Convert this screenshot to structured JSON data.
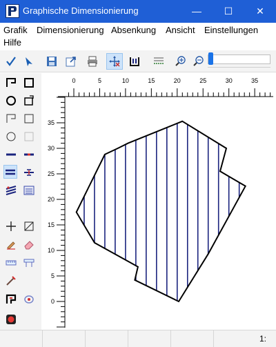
{
  "window": {
    "title": "Graphische Dimensionierung",
    "controls": {
      "minimize": "—",
      "maximize": "☐",
      "close": "✕"
    }
  },
  "menu": {
    "items": [
      "Grafik",
      "Dimensionierung",
      "Absenkung",
      "Ansicht",
      "Einstellungen",
      "Hilfe"
    ]
  },
  "toolbar": {
    "buttons": [
      "check-icon",
      "arrow-select-icon",
      "save-icon",
      "export-icon",
      "print-icon",
      "move-cross-icon",
      "area-icon",
      "grid-icon",
      "zoom-in-icon",
      "zoom-out-icon"
    ],
    "active_button": "move-cross-icon",
    "zoom_slider_level": 0.05,
    "accent_color": "#1a73e8"
  },
  "palette": {
    "tools": [
      "polygon-tool",
      "rectangle-tool",
      "circle-tool",
      "rotate-rect-tool",
      "polygon-outline-tool",
      "rectangle-outline-tool",
      "circle-outline-tool",
      "rectangle-light-tool",
      "line-tool",
      "line-red-tool",
      "parallel-lines-tool",
      "divide-tool",
      "hatch-tool",
      "table-tool",
      "cross-tool",
      "skew-rect-tool",
      "pencil-tool",
      "eraser-tool",
      "measure-tool",
      "table-edit-tool",
      "probe-tool",
      "polygon-red-tool",
      "ellipse-tool",
      "stop-tool"
    ]
  },
  "drawing": {
    "x_ticks": [
      "0",
      "5",
      "10",
      "15",
      "20",
      "25",
      "30",
      "35"
    ],
    "y_ticks": [
      "35",
      "30",
      "25",
      "20",
      "15",
      "10",
      "5",
      "0"
    ],
    "hatch_color": "#1a237e",
    "outline_color": "#000000"
  },
  "status": {
    "text": "1:"
  }
}
